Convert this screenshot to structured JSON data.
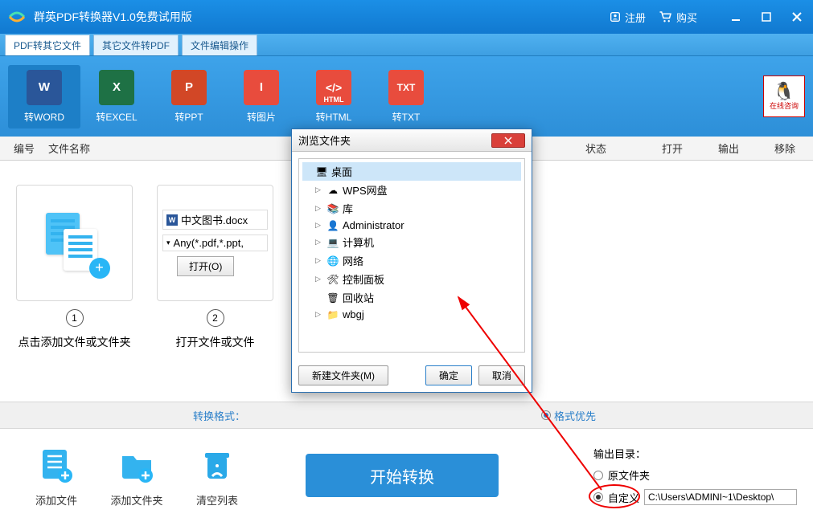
{
  "titlebar": {
    "app_title": "群英PDF转换器V1.0免费试用版",
    "register": "注册",
    "buy": "购买"
  },
  "tabs": [
    {
      "label": "PDF转其它文件",
      "active": true
    },
    {
      "label": "其它文件转PDF",
      "active": false
    },
    {
      "label": "文件编辑操作",
      "active": false
    }
  ],
  "formats": [
    {
      "label": "转WORD",
      "letter": "W",
      "bg": "#2a5699",
      "active": true
    },
    {
      "label": "转EXCEL",
      "letter": "X",
      "bg": "#1e7145"
    },
    {
      "label": "转PPT",
      "letter": "P",
      "bg": "#d24726"
    },
    {
      "label": "转图片",
      "letter": "I",
      "bg": "#e84c3d"
    },
    {
      "label": "转HTML",
      "letter": "</>",
      "bg": "#e84c3d",
      "sub": "HTML"
    },
    {
      "label": "转TXT",
      "letter": "TXT",
      "bg": "#e84c3d"
    }
  ],
  "qq_label": "在线咨询",
  "columns": {
    "c1": "编号",
    "c2": "文件名称",
    "c3": "状态",
    "c4": "打开",
    "c5": "输出",
    "c6": "移除"
  },
  "steps": {
    "s1": "点击添加文件或文件夹",
    "s2": "打开文件或文件",
    "file_name": "中文图书.docx",
    "file_filter": "Any(*.pdf,*.ppt,",
    "open_btn": "打开(O)"
  },
  "convert_format": {
    "label": "转换格式：",
    "opt_prefer_fmt": "格式优先"
  },
  "bottom": {
    "add_file": "添加文件",
    "add_folder": "添加文件夹",
    "clear_list": "清空列表",
    "start": "开始转换",
    "output_dir": "输出目录：",
    "orig_folder": "原文件夹",
    "custom": "自定义",
    "path": "C:\\Users\\ADMINI~1\\Desktop\\"
  },
  "dialog": {
    "title": "浏览文件夹",
    "btn_new": "新建文件夹(M)",
    "btn_ok": "确定",
    "btn_cancel": "取消",
    "tree": [
      {
        "label": "桌面",
        "icon": "🖥",
        "selected": true,
        "expandable": false,
        "indent": 0
      },
      {
        "label": "WPS网盘",
        "icon": "☁",
        "expandable": true,
        "indent": 1
      },
      {
        "label": "库",
        "icon": "📚",
        "expandable": true,
        "indent": 1
      },
      {
        "label": "Administrator",
        "icon": "👤",
        "expandable": true,
        "indent": 1
      },
      {
        "label": "计算机",
        "icon": "💻",
        "expandable": true,
        "indent": 1
      },
      {
        "label": "网络",
        "icon": "🌐",
        "expandable": true,
        "indent": 1
      },
      {
        "label": "控制面板",
        "icon": "🛠",
        "expandable": true,
        "indent": 1
      },
      {
        "label": "回收站",
        "icon": "🗑",
        "expandable": false,
        "indent": 1
      },
      {
        "label": "wbgj",
        "icon": "📁",
        "expandable": true,
        "indent": 1
      }
    ]
  }
}
